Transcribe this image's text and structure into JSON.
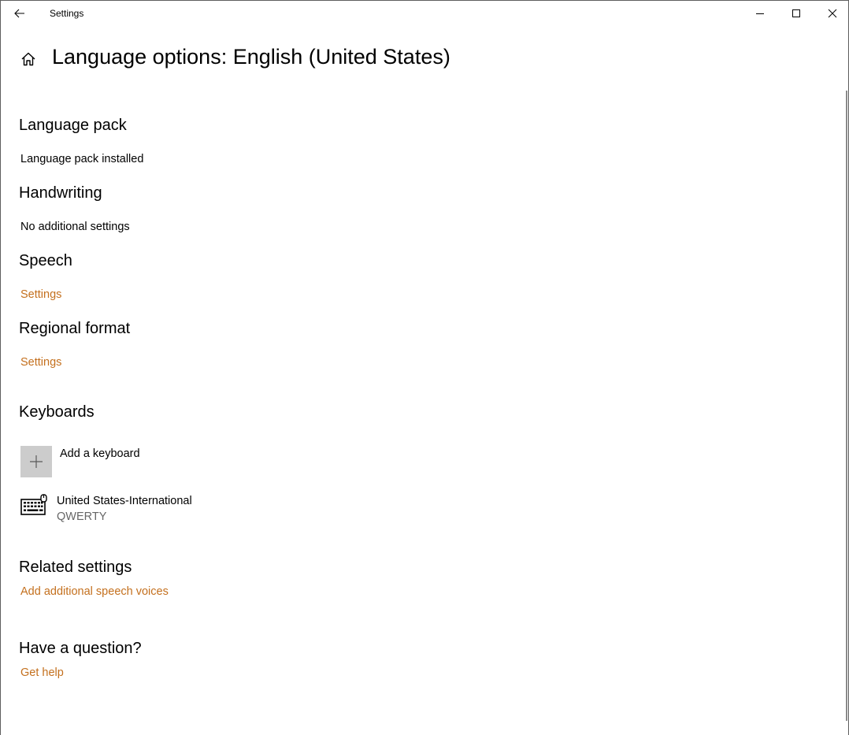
{
  "window": {
    "title": "Settings"
  },
  "page": {
    "title": "Language options: English (United States)"
  },
  "sections": {
    "language_pack": {
      "heading": "Language pack",
      "status": "Language pack installed"
    },
    "handwriting": {
      "heading": "Handwriting",
      "status": "No additional settings"
    },
    "speech": {
      "heading": "Speech",
      "link": "Settings"
    },
    "regional_format": {
      "heading": "Regional format",
      "link": "Settings"
    },
    "keyboards": {
      "heading": "Keyboards",
      "add_label": "Add a keyboard",
      "items": [
        {
          "name": "United States-International",
          "layout": "QWERTY",
          "icon": "keyboard-icon"
        }
      ]
    },
    "related_settings": {
      "heading": "Related settings",
      "link": "Add additional speech voices"
    },
    "help": {
      "heading": "Have a question?",
      "link": "Get help"
    }
  },
  "icons": {
    "back": "back-arrow-icon",
    "home": "home-icon",
    "minimize": "minimize-icon",
    "maximize": "maximize-icon",
    "close": "close-icon",
    "add": "plus-icon"
  },
  "colors": {
    "accent_link": "#c4701e",
    "secondary_text": "#666666",
    "add_tile": "#cccccc"
  }
}
